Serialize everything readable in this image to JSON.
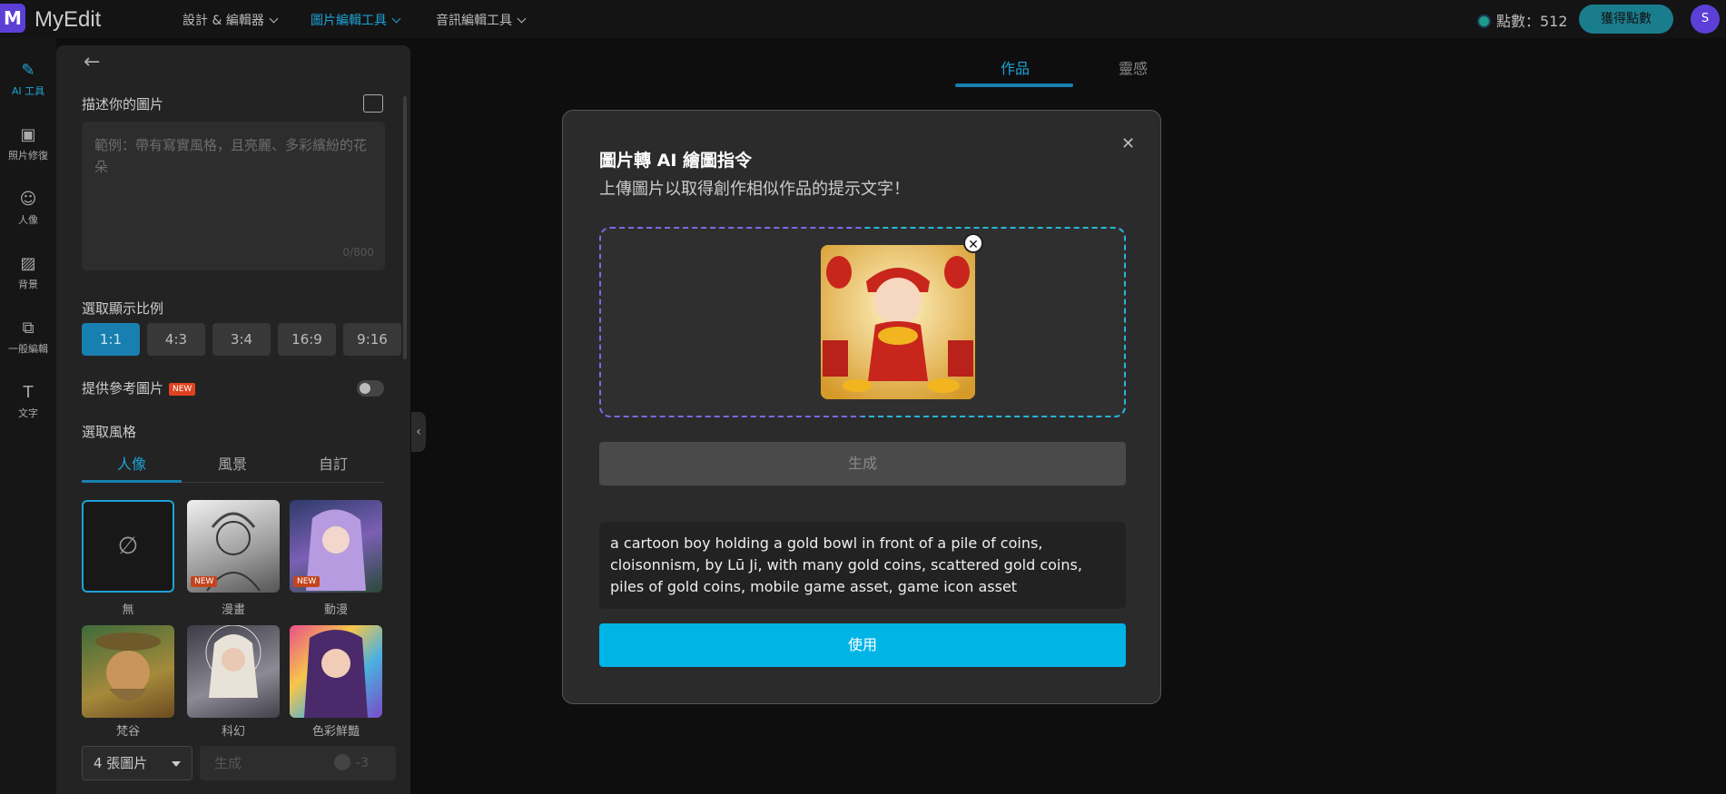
{
  "header": {
    "logo_text": "MyEdit",
    "nav": [
      {
        "label": "設計 & 編輯器"
      },
      {
        "label": "圖片編輯工具"
      },
      {
        "label": "音訊編輯工具"
      }
    ],
    "points_label": "點數：512",
    "earn_button": "獲得點數",
    "avatar_letter": "S"
  },
  "sidebar": {
    "items": [
      {
        "label": "AI 工具",
        "icon": "magic-wand-icon"
      },
      {
        "label": "照片修復",
        "icon": "image-icon"
      },
      {
        "label": "人像",
        "icon": "portrait-icon"
      },
      {
        "label": "背景",
        "icon": "background-icon"
      },
      {
        "label": "一般編輯",
        "icon": "crop-icon"
      },
      {
        "label": "文字",
        "icon": "text-icon"
      }
    ]
  },
  "panel": {
    "describe_label": "描述你的圖片",
    "describe_placeholder": "範例：帶有寫實風格，且亮麗、多彩繽紛的花朵",
    "describe_counter": "0/800",
    "ratio_label": "選取顯示比例",
    "ratios": [
      "1:1",
      "4:3",
      "3:4",
      "16:9",
      "9:16"
    ],
    "reference_label": "提供參考圖片",
    "new_badge": "NEW",
    "style_label": "選取風格",
    "style_tabs": [
      "人像",
      "風景",
      "自訂"
    ],
    "styles": [
      {
        "caption": "無"
      },
      {
        "caption": "漫畫"
      },
      {
        "caption": "動漫"
      },
      {
        "caption": "梵谷"
      },
      {
        "caption": "科幻"
      },
      {
        "caption": "色彩鮮豔"
      }
    ],
    "count_select": "4 張圖片",
    "generate_label": "生成",
    "generate_cost": "-3"
  },
  "main": {
    "tabs": [
      "作品",
      "靈感"
    ]
  },
  "modal": {
    "title": "圖片轉 AI 繪圖指令",
    "subtitle": "上傳圖片以取得創作相似作品的提示文字！",
    "generate_button": "生成",
    "result_text": "a cartoon boy holding a gold bowl in front of a pile of coins, cloisonnism, by Lū Ji, with many gold coins, scattered gold coins, piles of gold coins, mobile game asset, game icon asset",
    "use_button": "使用"
  },
  "colors": {
    "accent": "#00b4e6",
    "brand": "#5b3fd6",
    "active_tab": "#1fa3d6"
  }
}
